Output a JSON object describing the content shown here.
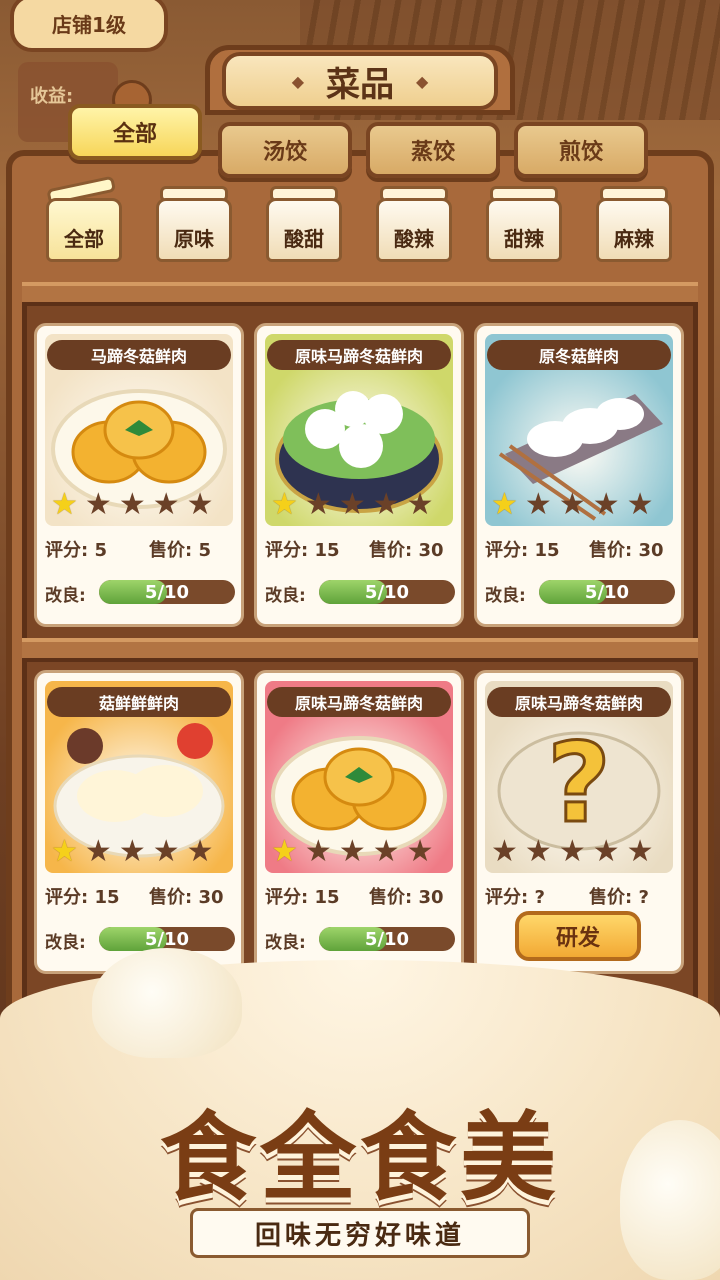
{
  "header": {
    "shop_level": "店铺1级",
    "income_label": "收益:"
  },
  "title": "菜品",
  "tabs": [
    {
      "label": "全部",
      "active": true
    },
    {
      "label": "汤饺",
      "active": false
    },
    {
      "label": "蒸饺",
      "active": false
    },
    {
      "label": "煎饺",
      "active": false
    }
  ],
  "flavors": [
    {
      "label": "全部",
      "active": true
    },
    {
      "label": "原味",
      "active": false
    },
    {
      "label": "酸甜",
      "active": false
    },
    {
      "label": "酸辣",
      "active": false
    },
    {
      "label": "甜辣",
      "active": false
    },
    {
      "label": "麻辣",
      "active": false
    }
  ],
  "cards": [
    {
      "name": "马蹄冬菇鲜肉",
      "stars": 1,
      "score": "评分: 5",
      "price": "售价: 5",
      "improve_label": "改良:",
      "improve_text": "5/10",
      "improve": 0.5,
      "bg": "#f3e3c6",
      "dish": "fried"
    },
    {
      "name": "原味马蹄冬菇鲜肉",
      "stars": 1,
      "score": "评分: 15",
      "price": "售价: 30",
      "improve_label": "改良:",
      "improve_text": "5/10",
      "improve": 0.5,
      "bg": "#cfd86a",
      "dish": "steamed"
    },
    {
      "name": "原冬菇鲜肉",
      "stars": 1,
      "score": "评分: 15",
      "price": "售价: 30",
      "improve_label": "改良:",
      "improve_text": "5/10",
      "improve": 0.5,
      "bg": "#8fc6d2",
      "dish": "plate"
    },
    {
      "name": "菇鲜鲜鲜肉",
      "stars": 1,
      "score": "评分: 15",
      "price": "售价: 30",
      "improve_label": "改良:",
      "improve_text": "5/10",
      "improve": 0.5,
      "bg": "#f6b64a",
      "dish": "pan"
    },
    {
      "name": "原味马蹄冬菇鲜肉",
      "stars": 1,
      "score": "评分: 15",
      "price": "售价: 30",
      "improve_label": "改良:",
      "improve_text": "5/10",
      "improve": 0.5,
      "bg": "#ef7b86",
      "dish": "fried"
    },
    {
      "name": "原味马蹄冬菇鲜肉",
      "stars": 0,
      "score": "评分: ?",
      "price": "售价: ?",
      "locked": true,
      "dev_label": "研发",
      "bg": "#e9dcc2",
      "dish": "unknown"
    }
  ],
  "slogan": {
    "big": "食全食美",
    "ribbon": "回味无穷好味道"
  },
  "colors": {
    "wood": "#a8693b",
    "dark_wood": "#6e3d1c",
    "star_on": "#f5d01a",
    "progress": "#5fa33a",
    "button": "#f2a934"
  }
}
